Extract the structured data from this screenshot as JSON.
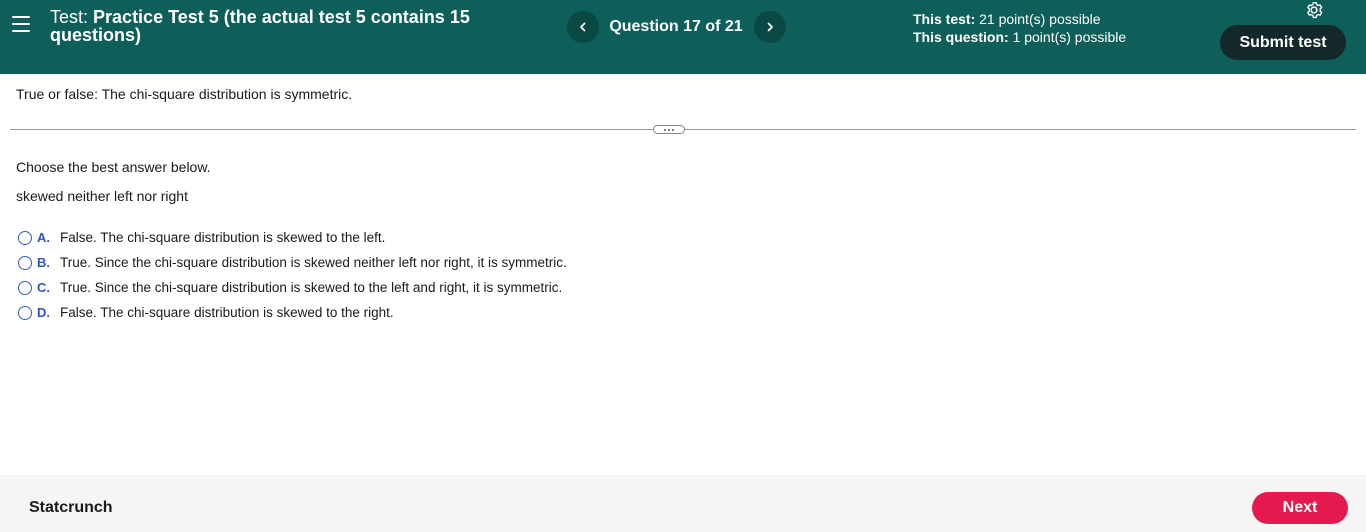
{
  "header": {
    "test_prefix": "Test:",
    "test_name": "Practice Test 5 (the actual test 5 contains 15 questions)",
    "question_counter": "Question 17 of 21",
    "this_test_label": "This test:",
    "this_test_value": "21 point(s) possible",
    "this_question_label": "This question:",
    "this_question_value": "1 point(s) possible",
    "submit_label": "Submit test",
    "icons": {
      "menu": "menu-icon",
      "prev": "chevron-left-icon",
      "next": "chevron-right-icon",
      "settings": "gear-icon"
    },
    "colors": {
      "background": "#0e5e5a",
      "submit": "#14282b"
    }
  },
  "question": {
    "text": "True or false: The chi-square distribution is symmetric.",
    "instruction": "Choose the best answer below.",
    "hint": "skewed neither left nor right",
    "options": [
      {
        "letter": "A.",
        "text": "False. The chi-square distribution is skewed to the left."
      },
      {
        "letter": "B.",
        "text": "True. Since the chi-square distribution is skewed neither left nor right, it is symmetric."
      },
      {
        "letter": "C.",
        "text": "True. Since the chi-square distribution is skewed to the left and right, it is symmetric."
      },
      {
        "letter": "D.",
        "text": "False. The chi-square distribution is skewed to the right."
      }
    ]
  },
  "footer": {
    "statcrunch_label": "Statcrunch",
    "next_label": "Next",
    "colors": {
      "next": "#e5194d"
    }
  }
}
